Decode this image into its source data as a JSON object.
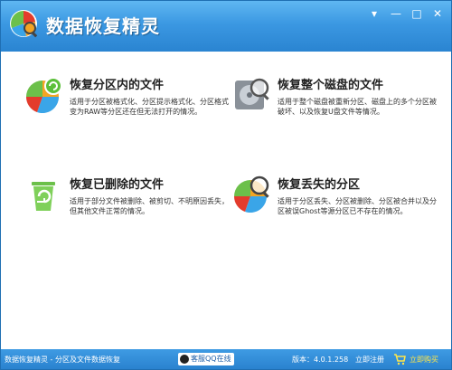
{
  "window": {
    "title": "数据恢复精灵",
    "controls": [
      "menu-icon",
      "minimize-icon",
      "maximize-icon",
      "close-icon"
    ]
  },
  "cards": [
    {
      "title": "恢复分区内的文件",
      "desc": "适用于分区被格式化、分区提示格式化、分区格式变为RAW等分区还在但无法打开的情况。",
      "icon": "pie-recycle-icon"
    },
    {
      "title": "恢复整个磁盘的文件",
      "desc": "适用于整个磁盘被重新分区、磁盘上的多个分区被破坏、以及恢复U盘文件等情况。",
      "icon": "harddisk-magnifier-icon"
    },
    {
      "title": "恢复已删除的文件",
      "desc": "适用于部分文件被删除、被剪切、不明原因丢失，但其他文件正常的情况。",
      "icon": "recycle-bin-icon"
    },
    {
      "title": "恢复丢失的分区",
      "desc": "适用于分区丢失、分区被删除、分区被合并以及分区被误Ghost等源分区已不存在的情况。",
      "icon": "pie-magnifier-icon"
    }
  ],
  "statusbar": {
    "product": "数据恢复精灵 - 分区及文件数据恢复",
    "support": "客服QQ在线",
    "version": "版本：4.0.1.258",
    "register": "立即注册",
    "buy": "立即购买"
  },
  "colors": {
    "titlebar": "#3b98e2",
    "statusbar": "#2a82cf",
    "buy_text": "#ffe64a"
  }
}
